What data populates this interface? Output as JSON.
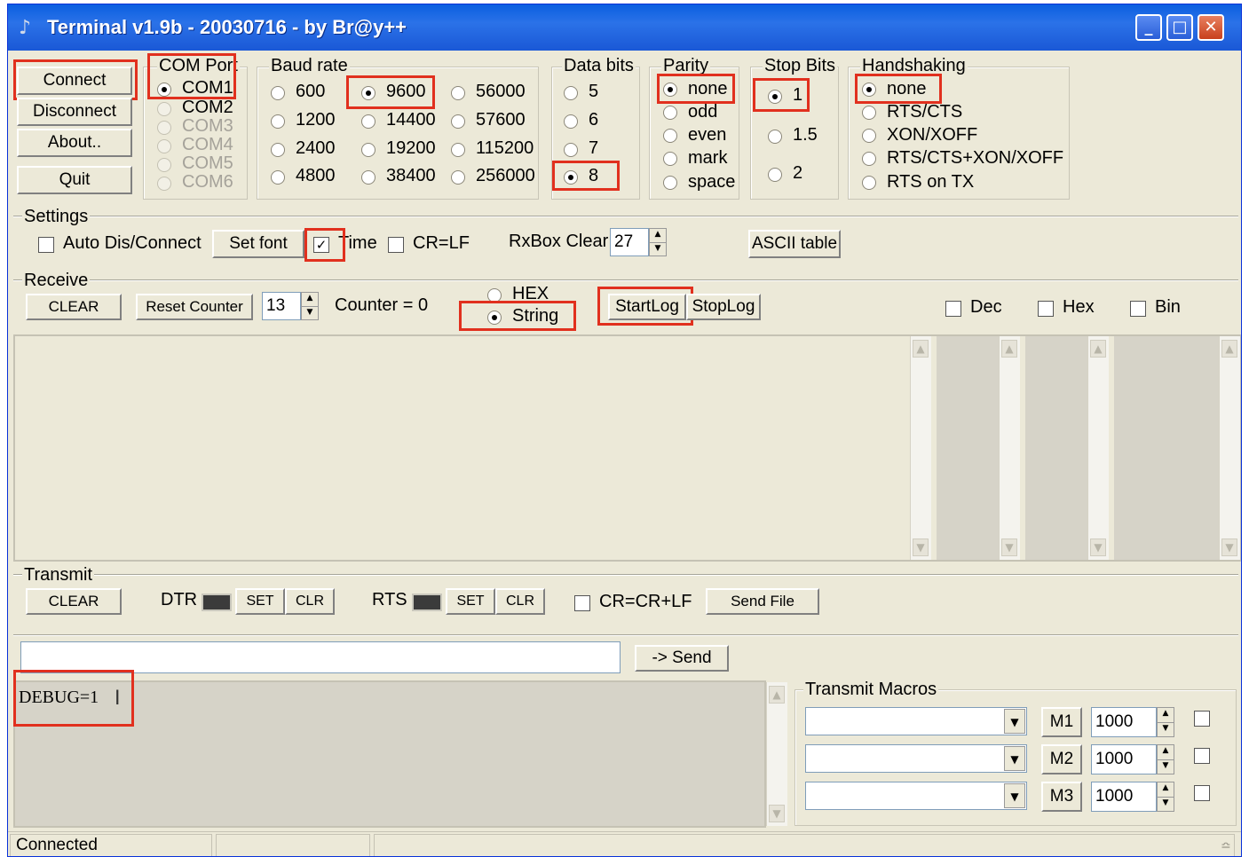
{
  "window": {
    "title": "Terminal v1.9b - 20030716 - by Br@y++"
  },
  "buttons": {
    "connect": "Connect",
    "disconnect": "Disconnect",
    "about": "About..",
    "quit": "Quit"
  },
  "com_port": {
    "title": "COM Port",
    "options": [
      "COM1",
      "COM2",
      "COM3",
      "COM4",
      "COM5",
      "COM6"
    ],
    "selected": "COM1"
  },
  "baud_rate": {
    "title": "Baud rate",
    "options": [
      "600",
      "1200",
      "2400",
      "4800",
      "9600",
      "14400",
      "19200",
      "38400",
      "56000",
      "57600",
      "115200",
      "256000"
    ],
    "selected": "9600"
  },
  "data_bits": {
    "title": "Data bits",
    "options": [
      "5",
      "6",
      "7",
      "8"
    ],
    "selected": "8"
  },
  "parity": {
    "title": "Parity",
    "options": [
      "none",
      "odd",
      "even",
      "mark",
      "space"
    ],
    "selected": "none"
  },
  "stop_bits": {
    "title": "Stop Bits",
    "options": [
      "1",
      "1.5",
      "2"
    ],
    "selected": "1"
  },
  "handshaking": {
    "title": "Handshaking",
    "options": [
      "none",
      "RTS/CTS",
      "XON/XOFF",
      "RTS/CTS+XON/XOFF",
      "RTS on TX"
    ],
    "selected": "none"
  },
  "settings": {
    "title": "Settings",
    "auto_dis_connect": "Auto Dis/Connect",
    "set_font": "Set font",
    "time": "Time",
    "cr_lf": "CR=LF",
    "rxbox_clear": "RxBox Clear",
    "rxbox_value": "27",
    "ascii_table": "ASCII table"
  },
  "receive": {
    "title": "Receive",
    "clear": "CLEAR",
    "reset_counter": "Reset Counter",
    "counter_spin": "13",
    "counter_text": "Counter = 0",
    "hex": "HEX",
    "string": "String",
    "selected_mode": "String",
    "start_log": "StartLog",
    "stop_log": "StopLog",
    "dec": "Dec",
    "hex_check": "Hex",
    "bin": "Bin"
  },
  "transmit": {
    "title": "Transmit",
    "clear": "CLEAR",
    "dtr": "DTR",
    "rts": "RTS",
    "set": "SET",
    "clr": "CLR",
    "cr_crlf": "CR=CR+LF",
    "send_file": "Send File",
    "send": "-> Send",
    "input_value": "",
    "text_area": "DEBUG=1"
  },
  "macros": {
    "title": "Transmit Macros",
    "items": [
      {
        "label": "M1",
        "value": "1000"
      },
      {
        "label": "M2",
        "value": "1000"
      },
      {
        "label": "M3",
        "value": "1000"
      }
    ]
  },
  "statusbar": {
    "status": "Connected"
  },
  "colors": {
    "highlight": "#e1301e",
    "title_bar": "#0a5fe0",
    "window_bg": "#ece9d8"
  },
  "icons": [
    "app-icon",
    "minimize-icon",
    "maximize-icon",
    "close-icon",
    "scroll-up-icon",
    "scroll-down-icon",
    "dropdown-arrow-icon",
    "text-cursor-icon",
    "resize-grip-icon"
  ]
}
